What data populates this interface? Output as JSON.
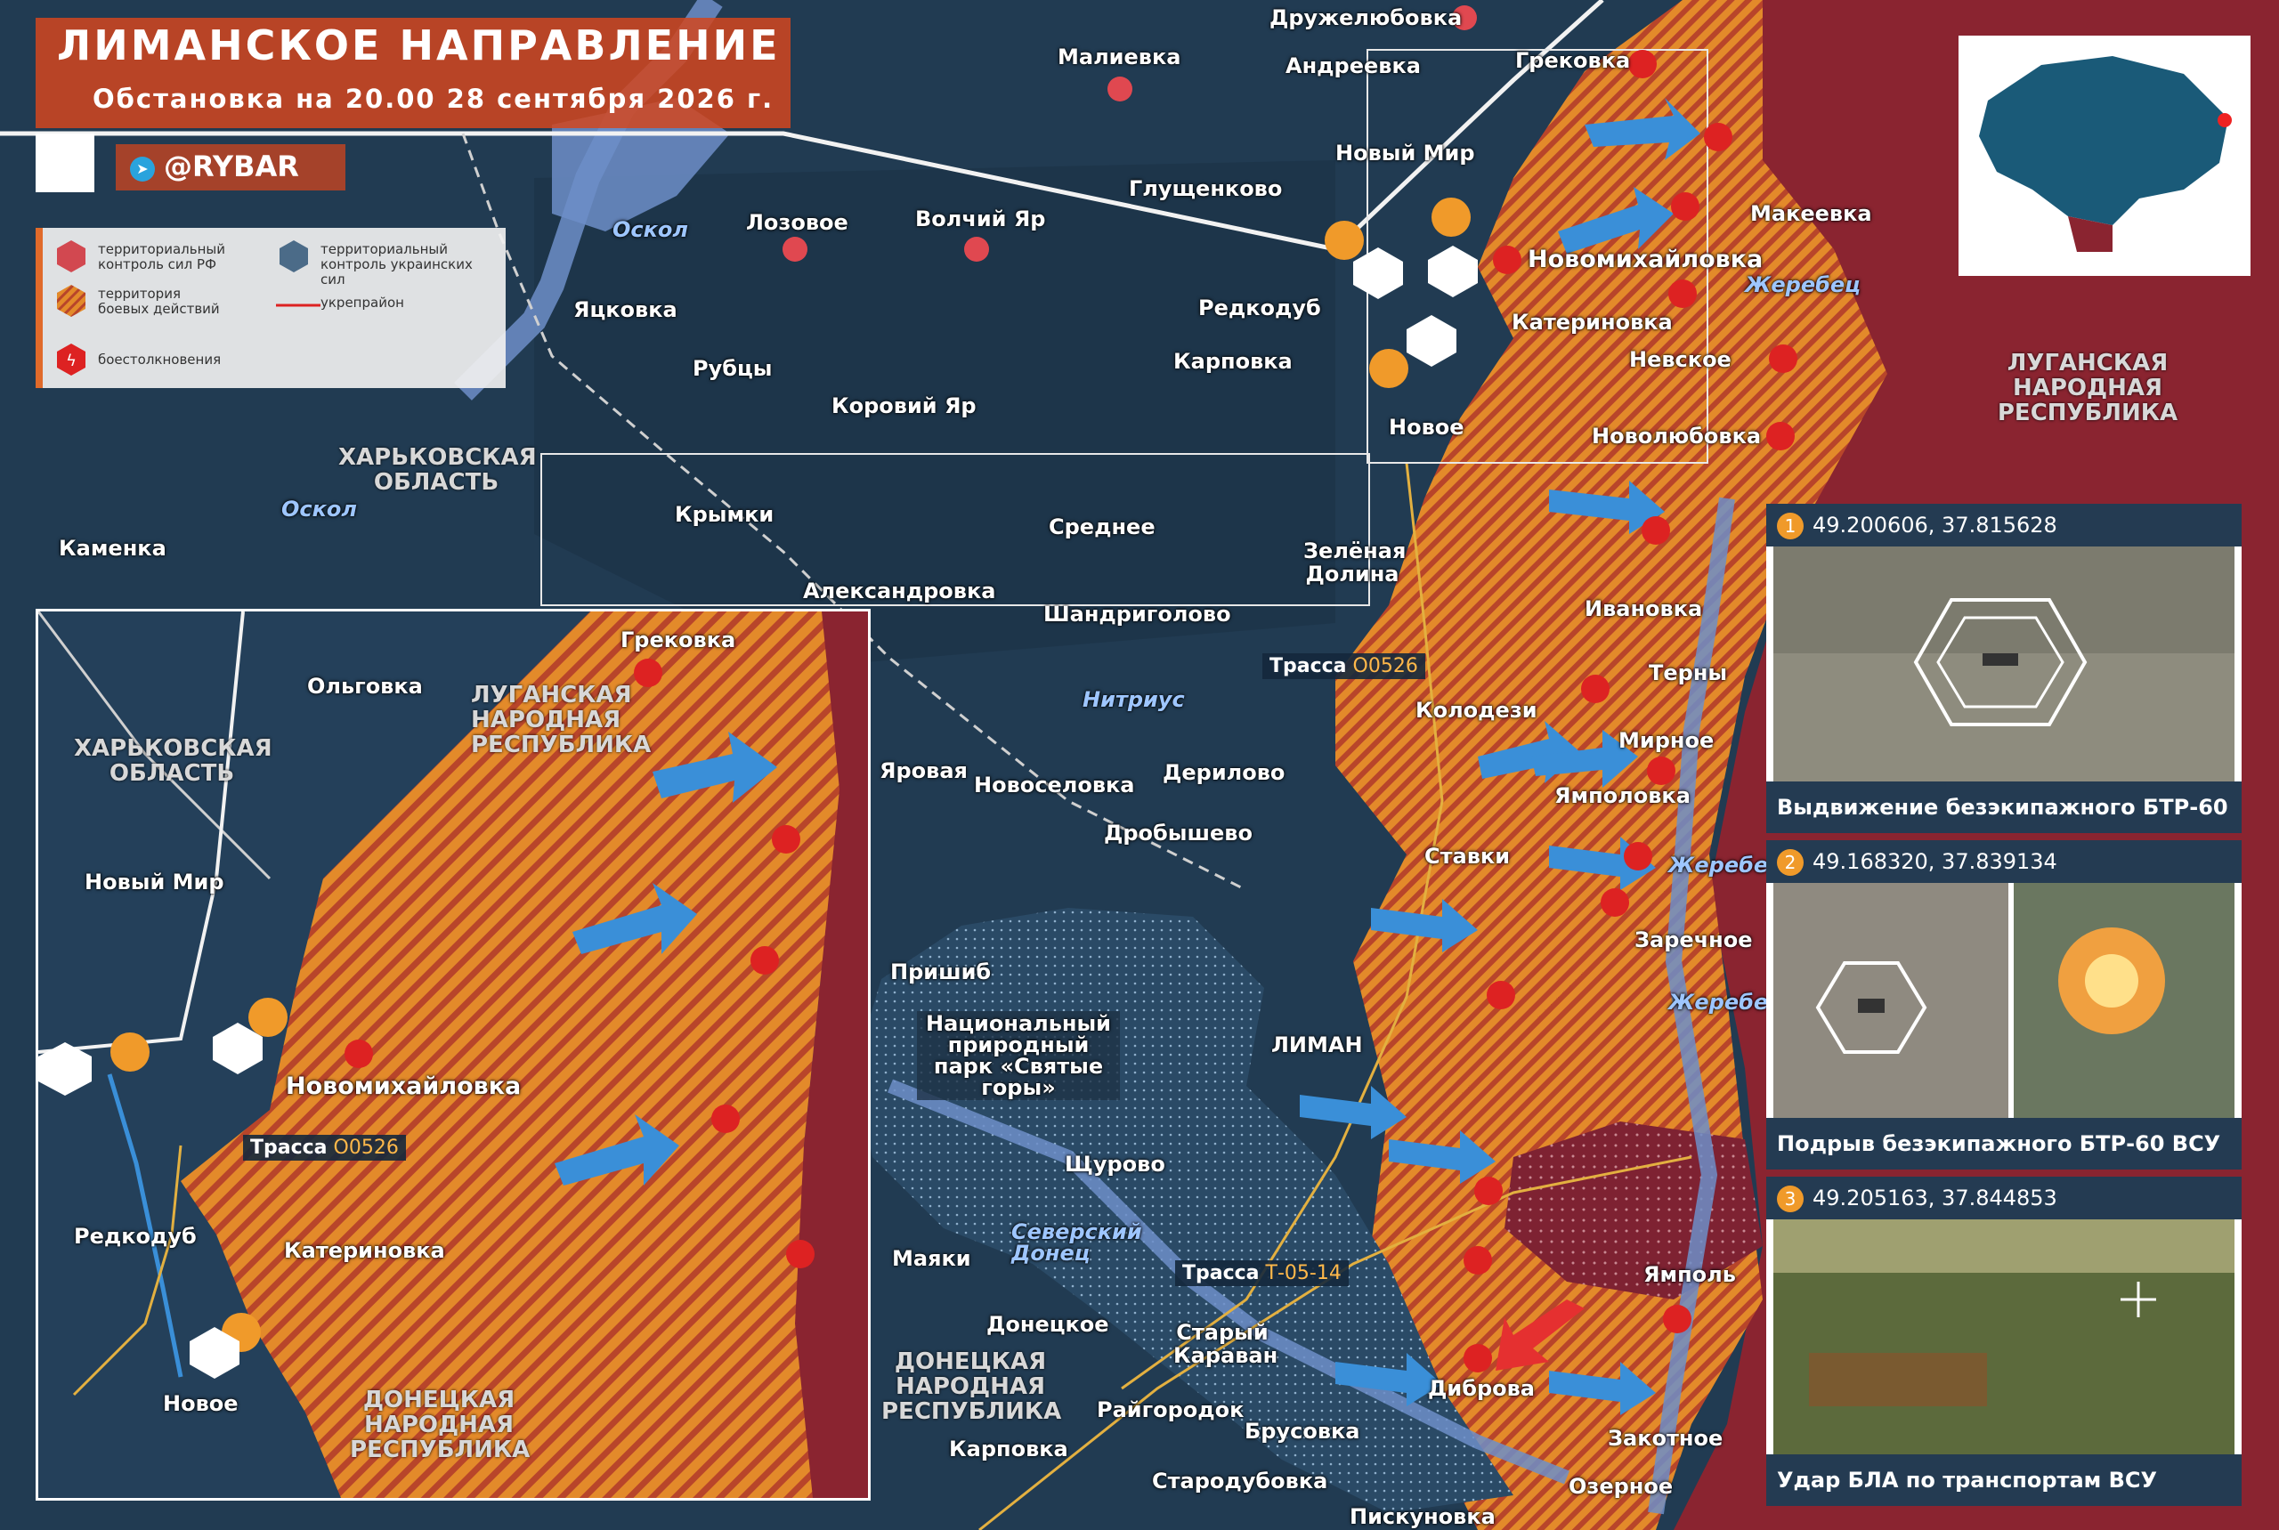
{
  "header": {
    "title": "ЛИМАНСКОЕ НАПРАВЛЕНИЕ",
    "subtitle": "Обстановка на 20.00 28 сентября 2026 г.",
    "channel": "@RYBAR"
  },
  "legend": {
    "ru_control": "территориальный контроль сил РФ",
    "ua_control": "территориальный контроль украинских сил",
    "combat_zone": "территория боевых действий",
    "fortified": "укрепрайон",
    "clashes": "боестолкновения"
  },
  "colors": {
    "ru": "#8a2430",
    "ua": "#234057",
    "combat": "#e38a2a",
    "arrow": "#3a8fd8",
    "accent": "#d2461e"
  },
  "regions": {
    "kharkiv": "ХАРЬКОВСКАЯ ОБЛАСТЬ",
    "lugansk": "ЛУГАНСКАЯ НАРОДНАЯ РЕСПУБЛИКА",
    "donetsk": "ДОНЕЦКАЯ НАРОДНАЯ РЕСПУБЛИКА",
    "park": "Национальный природный парк «Святые горы»"
  },
  "rivers": {
    "oskol": "Оскол",
    "zherebets": "Жеребец",
    "nitrius": "Нитриус",
    "donets": "Северский Донец"
  },
  "roads": {
    "prefix": "Трасса",
    "r1": "О0526",
    "r2": "Т-05-14"
  },
  "places": {
    "druzhelyubovka": "Дружелюбовка",
    "malievka": "Малиевка",
    "andreevka": "Андреевка",
    "grekovka": "Грековка",
    "novy_mir": "Новый Мир",
    "glushchenkovo": "Глущенково",
    "lozovoe": "Лозовое",
    "volchiy_yar": "Волчий Яр",
    "yatskovka": "Яцковка",
    "rubtsy": "Рубцы",
    "redkodub": "Редкодуб",
    "karpovka": "Карповка",
    "koroviy_yar": "Коровий Яр",
    "novomikhaylovka": "Новомихайловка",
    "katerinovka": "Катериновка",
    "nevskoe": "Невское",
    "novoe": "Новое",
    "novolyubovka": "Новолюбовка",
    "makeevka": "Макеевка",
    "krymki": "Крымки",
    "kamenka": "Каменка",
    "aleksandrovka": "Александровка",
    "srednee": "Среднее",
    "zelenaya_dolina": "Зелёная Долина",
    "shandrigolovo": "Шандриголово",
    "ivanovka": "Ивановка",
    "terny": "Терны",
    "kolodezi": "Колодези",
    "mirnoe": "Мирное",
    "yampolovka": "Ямполовка",
    "yarovaya": "Яровая",
    "novoselovka": "Новоселовка",
    "derilovo": "Дерилово",
    "drobyshevo": "Дробышево",
    "stavki": "Ставки",
    "zarechnoe": "Заречное",
    "prishib": "Пришиб",
    "liman": "ЛИМАН",
    "shchurovo": "Щурово",
    "mayaki": "Маяки",
    "donetskoe": "Донецкое",
    "stary_karavan": "Старый Караван",
    "yampol": "Ямполь",
    "dibrova": "Диброва",
    "raygorodok": "Райгородок",
    "brusovka": "Брусовка",
    "zakotnoe": "Закотное",
    "karpovka2": "Карповка",
    "starodubovka": "Стародубовка",
    "ozernoe": "Озерное",
    "piskunovka": "Пискуновка",
    "olgovka": "Ольговка"
  },
  "markers": [
    "1",
    "2",
    "3"
  ],
  "photos": [
    {
      "num": "1",
      "coords": "49.200606, 37.815628",
      "caption": "Выдвижение безэкипажного БТР-60 ВСУ"
    },
    {
      "num": "2",
      "coords": "49.168320, 37.839134",
      "caption": "Подрыв безэкипажного БТР-60 ВСУ"
    },
    {
      "num": "3",
      "coords": "49.205163, 37.844853",
      "caption": "Удар БЛА по транспортам ВСУ"
    }
  ],
  "minimap_region": "ЛНР"
}
